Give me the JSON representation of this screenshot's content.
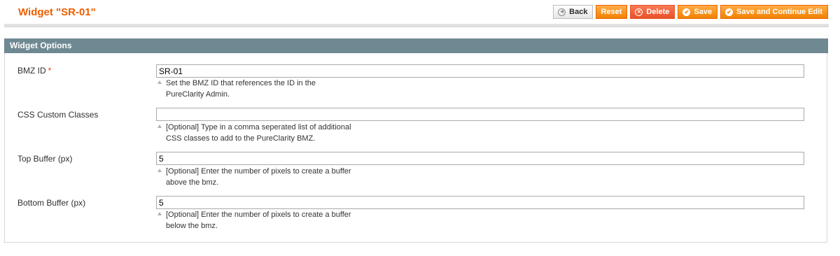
{
  "header": {
    "title": "Widget \"SR-01\"",
    "buttons": {
      "back": "Back",
      "reset": "Reset",
      "delete": "Delete",
      "save": "Save",
      "save_continue": "Save and Continue Edit"
    }
  },
  "panel": {
    "title": "Widget Options",
    "fields": {
      "bmz_id": {
        "label": "BMZ ID",
        "required_mark": "*",
        "value": "SR-01",
        "note_line1": "Set the BMZ ID that references the ID in the",
        "note_line2": "PureClarity Admin."
      },
      "css_classes": {
        "label": "CSS Custom Classes",
        "value": "",
        "note_line1": "[Optional] Type in a comma seperated list of additional",
        "note_line2": "CSS classes to add to the PureClarity BMZ."
      },
      "top_buffer": {
        "label": "Top Buffer (px)",
        "value": "5",
        "note_line1": "[Optional] Enter the number of pixels to create a buffer",
        "note_line2": "above the bmz."
      },
      "bottom_buffer": {
        "label": "Bottom Buffer (px)",
        "value": "5",
        "note_line1": "[Optional] Enter the number of pixels to create a buffer",
        "note_line2": "below the bmz."
      }
    }
  },
  "colors": {
    "title": "#eb5e00",
    "button_orange": "#f18200",
    "button_delete": "#e95027",
    "panel_header": "#6f8992",
    "required": "#eb340a"
  },
  "icons": {
    "back": "arrow-left-circle-icon",
    "delete": "x-circle-icon",
    "save": "check-circle-icon",
    "save_continue": "check-circle-icon",
    "note": "caret-up-icon"
  }
}
